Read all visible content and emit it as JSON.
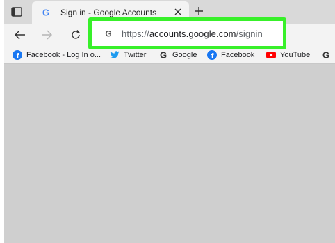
{
  "tab": {
    "title": "Sign in - Google Accounts",
    "favicon": "google-g-icon"
  },
  "address_bar": {
    "url_scheme": "https://",
    "url_domain": "accounts.google.com",
    "url_path": "/signin",
    "highlight_color": "#38f02a"
  },
  "bookmarks": [
    {
      "label": "Facebook - Log In o...",
      "icon": "facebook-icon"
    },
    {
      "label": "Twitter",
      "icon": "twitter-icon"
    },
    {
      "label": "Google",
      "icon": "google-g-icon"
    },
    {
      "label": "Facebook",
      "icon": "facebook-icon"
    },
    {
      "label": "YouTube",
      "icon": "youtube-icon"
    },
    {
      "label": "",
      "icon": "google-g-icon"
    }
  ],
  "colors": {
    "facebook": "#1877f2",
    "twitter": "#1d9bf0",
    "youtube": "#ff0000",
    "google_blue": "#4285f4"
  }
}
